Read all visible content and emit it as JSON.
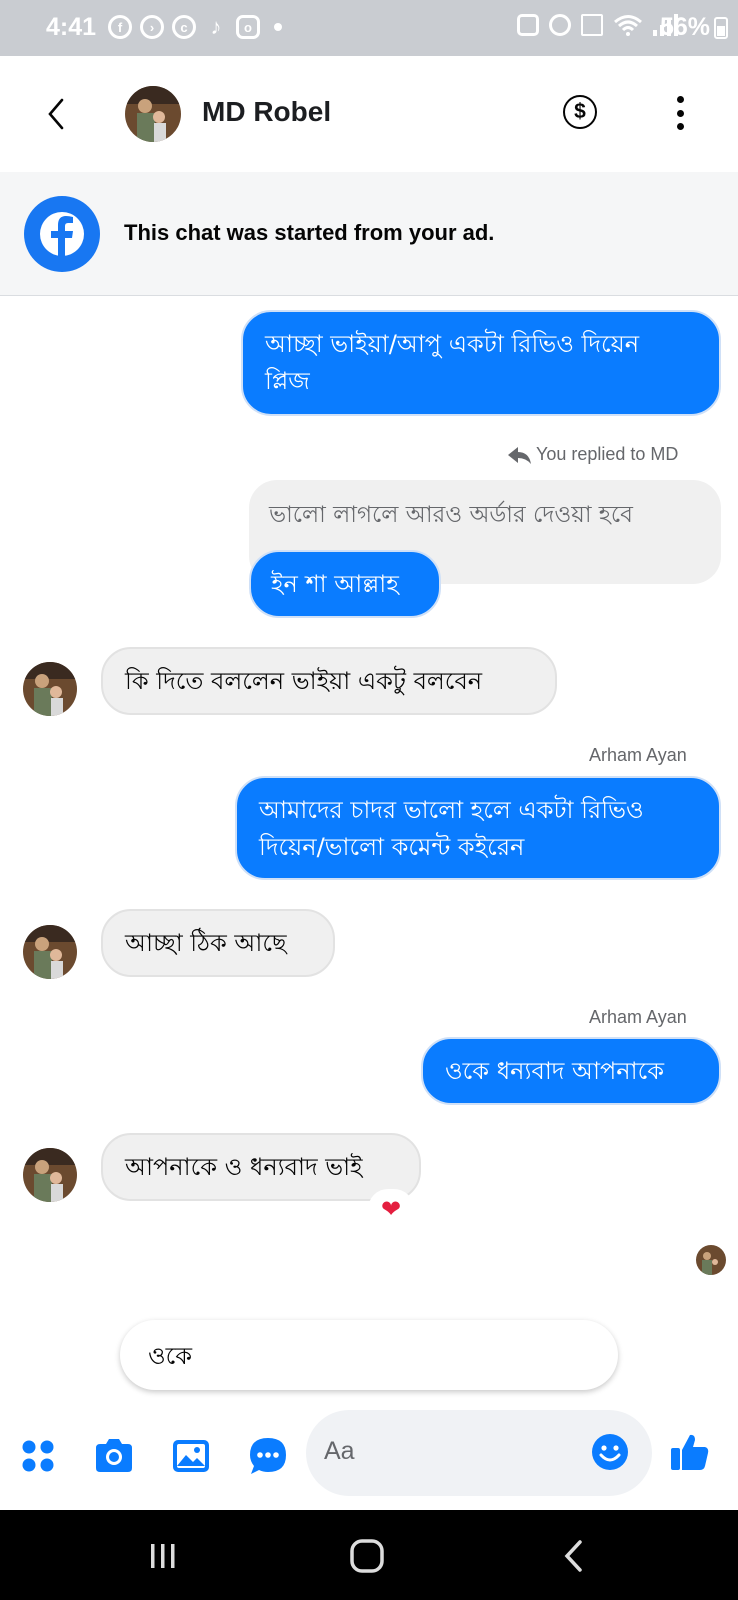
{
  "status_bar": {
    "time": "4:41",
    "battery": "56%",
    "left_icons": [
      "facebook-icon",
      "messenger-icon",
      "contact-icon",
      "tiktok-icon",
      "instagram-icon",
      "dot-icon"
    ],
    "right_icons": [
      "lock-icon",
      "alarm-icon",
      "mute-icon",
      "wifi-icon",
      "signal-icon",
      "battery-icon"
    ]
  },
  "header": {
    "contact_name": "MD Robel",
    "dollar_symbol": "$"
  },
  "ad_banner": {
    "text": "This chat was started from your ad."
  },
  "messages": {
    "m1": {
      "line1": "আচ্ছা ভাইয়া/আপু একটা রিভিও দিয়েন",
      "line2": "প্লিজ"
    },
    "reply_meta": "You replied to MD",
    "reply_quote": "ভালো লাগলে আরও অর্ডার দেওয়া হবে",
    "m2": "ইন শা আল্লাহ",
    "m3": "কি দিতে বললেন ভাইয়া একটু বলবেন",
    "sender1": "Arham Ayan",
    "m4": {
      "line1": "আমাদের চাদর ভালো হলে একটা রিভিও",
      "line2": "দিয়েন/ভালো কমেন্ট কইরেন"
    },
    "m5": "আচ্ছা ঠিক আছে",
    "sender2": "Arham Ayan",
    "m6": "ওকে ধন্যবাদ আপনাকে",
    "m7": "আপনাকে ও ধন্যবাদ ভাই",
    "reaction": "❤"
  },
  "suggestion": "ওকে",
  "composer": {
    "placeholder": "Aa"
  },
  "colors": {
    "outgoing_bubble": "#0a7cff",
    "incoming_bubble": "#f0f0f0",
    "accent": "#1877f2",
    "status_bar_bg": "#c9ccd1"
  }
}
